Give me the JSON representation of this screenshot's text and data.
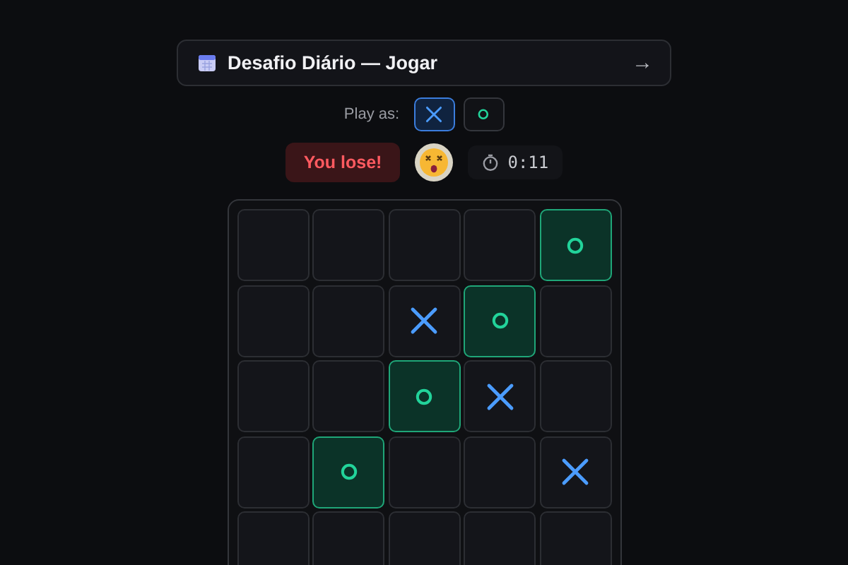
{
  "header": {
    "title": "Desafio Diário — Jogar",
    "arrow": "→"
  },
  "play_as": {
    "label": "Play as:",
    "options": [
      {
        "kind": "x",
        "selected": true
      },
      {
        "kind": "o",
        "selected": false
      }
    ]
  },
  "status": {
    "result": "You lose!",
    "timer": "0:11"
  },
  "board": {
    "rows": [
      [
        {
          "kind": "empty",
          "winning": false
        },
        {
          "kind": "empty",
          "winning": false
        },
        {
          "kind": "empty",
          "winning": false
        },
        {
          "kind": "empty",
          "winning": false
        },
        {
          "kind": "o",
          "winning": true
        }
      ],
      [
        {
          "kind": "empty",
          "winning": false
        },
        {
          "kind": "empty",
          "winning": false
        },
        {
          "kind": "x",
          "winning": false
        },
        {
          "kind": "o",
          "winning": true
        },
        {
          "kind": "empty",
          "winning": false
        }
      ],
      [
        {
          "kind": "empty",
          "winning": false
        },
        {
          "kind": "empty",
          "winning": false
        },
        {
          "kind": "o",
          "winning": true
        },
        {
          "kind": "x",
          "winning": false
        },
        {
          "kind": "empty",
          "winning": false
        }
      ],
      [
        {
          "kind": "empty",
          "winning": false
        },
        {
          "kind": "o",
          "winning": true
        },
        {
          "kind": "empty",
          "winning": false
        },
        {
          "kind": "empty",
          "winning": false
        },
        {
          "kind": "x",
          "winning": false
        }
      ],
      [
        {
          "kind": "empty",
          "winning": false
        },
        {
          "kind": "empty",
          "winning": false
        },
        {
          "kind": "empty",
          "winning": false
        },
        {
          "kind": "empty",
          "winning": false
        },
        {
          "kind": "empty",
          "winning": false
        }
      ]
    ]
  }
}
